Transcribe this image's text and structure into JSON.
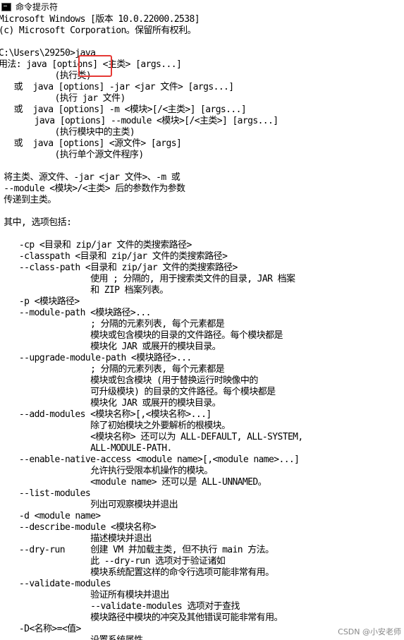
{
  "window": {
    "title": "命令提示符"
  },
  "console": {
    "lines": [
      "Microsoft Windows [版本 10.0.22000.2538]",
      "(c) Microsoft Corporation。保留所有权利。",
      "",
      "C:\\Users\\29250>java",
      "用法: java [options] <主类> [args...]",
      "           (执行类)",
      "   或  java [options] -jar <jar 文件> [args...]",
      "           (执行 jar 文件)",
      "   或  java [options] -m <模块>[/<主类>] [args...]",
      "       java [options] --module <模块>[/<主类>] [args...]",
      "           (执行模块中的主类)",
      "   或  java [options] <源文件> [args]",
      "           (执行单个源文件程序)",
      "",
      " 将主类、源文件、-jar <jar 文件>、-m 或",
      " --module <模块>/<主类> 后的参数作为参数",
      " 传递到主类。",
      "",
      " 其中, 选项包括:",
      "",
      "    -cp <目录和 zip/jar 文件的类搜索路径>",
      "    -classpath <目录和 zip/jar 文件的类搜索路径>",
      "    --class-path <目录和 zip/jar 文件的类搜索路径>",
      "                  使用 ; 分隔的, 用于搜索类文件的目录, JAR 档案",
      "                  和 ZIP 档案列表。",
      "    -p <模块路径>",
      "    --module-path <模块路径>...",
      "                  ; 分隔的元素列表, 每个元素都是",
      "                  模块或包含模块的目录的文件路径。每个模块都是",
      "                  模块化 JAR 或展开的模块目录。",
      "    --upgrade-module-path <模块路径>...",
      "                  ; 分隔的元素列表, 每个元素都是",
      "                  模块或包含模块 (用于替换运行时映像中的",
      "                  可升级模块) 的目录的文件路径。每个模块都是",
      "                  模块化 JAR 或展开的模块目录。",
      "    --add-modules <模块名称>[,<模块名称>...]",
      "                  除了初始模块之外要解析的根模块。",
      "                  <模块名称> 还可以为 ALL-DEFAULT, ALL-SYSTEM,",
      "                  ALL-MODULE-PATH.",
      "    --enable-native-access <module name>[,<module name>...]",
      "                  允许执行受限本机操作的模块。",
      "                  <module name> 还可以是 ALL-UNNAMED。",
      "    --list-modules",
      "                  列出可观察模块并退出",
      "    -d <module name>",
      "    --describe-module <模块名称>",
      "                  描述模块并退出",
      "    --dry-run     创建 VM 并加载主类, 但不执行 main 方法。",
      "                  此 --dry-run 选项对于验证诸如",
      "                  模块系统配置这样的命令行选项可能非常有用。",
      "    --validate-modules",
      "                  验证所有模块并退出",
      "                  --validate-modules 选项对于查找",
      "                  模块路径中模块的冲突及其他错误可能非常有用。",
      "    -D<名称>=<值>",
      "                  设置系统属性"
    ]
  },
  "watermark": {
    "text": "CSDN @小安老师"
  },
  "colors": {
    "highlight_box": "#e53935",
    "background": "#ffffff",
    "text": "#000000"
  }
}
